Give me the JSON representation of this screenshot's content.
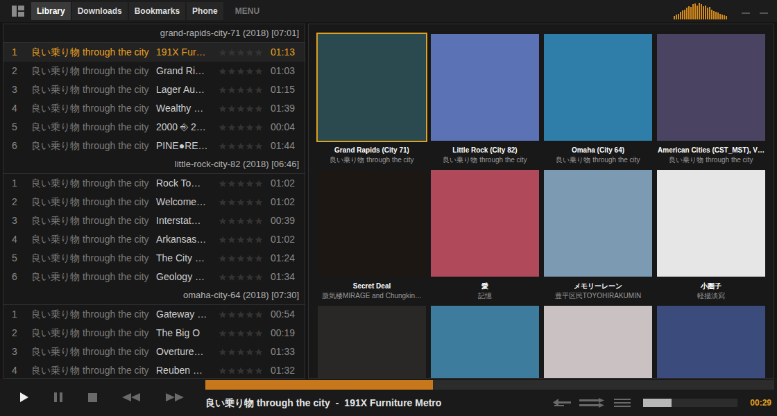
{
  "tabs": [
    {
      "label": "Library",
      "selected": true
    },
    {
      "label": "Downloads",
      "selected": false
    },
    {
      "label": "Bookmarks",
      "selected": false
    },
    {
      "label": "Phone",
      "selected": false
    }
  ],
  "menu": "MENU",
  "spectrum": [
    0.2,
    0.3,
    0.35,
    0.45,
    0.55,
    0.6,
    0.7,
    0.8,
    0.75,
    0.9,
    0.95,
    0.85,
    1,
    0.9,
    0.8,
    0.85,
    0.7,
    0.75,
    0.6,
    0.5,
    0.45,
    0.4,
    0.35,
    0.3,
    0.25,
    0.2
  ],
  "library": {
    "groups": [
      {
        "header": "grand-rapids-city-71 (2018) [07:01]",
        "tracks": [
          {
            "number": "1",
            "artist": "良い乗り物 through the city",
            "title": "191X Fur…",
            "stars": 0,
            "duration": "01:13",
            "selected": true
          },
          {
            "number": "2",
            "artist": "良い乗り物 through the city",
            "title": "Grand Ri…",
            "stars": 0,
            "duration": "01:03",
            "selected": false
          },
          {
            "number": "3",
            "artist": "良い乗り物 through the city",
            "title": "Lager Au…",
            "stars": 0,
            "duration": "01:15",
            "selected": false
          },
          {
            "number": "4",
            "artist": "良い乗り物 through the city",
            "title": "Wealthy …",
            "stars": 0,
            "duration": "01:39",
            "selected": false
          },
          {
            "number": "5",
            "artist": "良い乗り物 through the city",
            "title": "2000 ⎆ 2…",
            "stars": 0,
            "duration": "00:04",
            "selected": false
          },
          {
            "number": "6",
            "artist": "良い乗り物 through the city",
            "title": "PINE●RE…",
            "stars": 0,
            "duration": "01:44",
            "selected": false
          }
        ]
      },
      {
        "header": "little-rock-city-82 (2018) [06:46]",
        "tracks": [
          {
            "number": "1",
            "artist": "良い乗り物 through the city",
            "title": "Rock To…",
            "stars": 0,
            "duration": "01:02",
            "selected": false
          },
          {
            "number": "2",
            "artist": "良い乗り物 through the city",
            "title": "Welcome…",
            "stars": 0,
            "duration": "01:02",
            "selected": false
          },
          {
            "number": "3",
            "artist": "良い乗り物 through the city",
            "title": "Interstat…",
            "stars": 0,
            "duration": "00:39",
            "selected": false
          },
          {
            "number": "4",
            "artist": "良い乗り物 through the city",
            "title": "Arkansas…",
            "stars": 0,
            "duration": "01:02",
            "selected": false
          },
          {
            "number": "5",
            "artist": "良い乗り物 through the city",
            "title": "The City …",
            "stars": 0,
            "duration": "01:24",
            "selected": false
          },
          {
            "number": "6",
            "artist": "良い乗り物 through the city",
            "title": "Geology …",
            "stars": 0,
            "duration": "01:34",
            "selected": false
          }
        ]
      },
      {
        "header": "omaha-city-64 (2018) [07:30]",
        "tracks": [
          {
            "number": "1",
            "artist": "良い乗り物 through the city",
            "title": "Gateway …",
            "stars": 0,
            "duration": "00:54",
            "selected": false
          },
          {
            "number": "2",
            "artist": "良い乗り物 through the city",
            "title": "The Big O",
            "stars": 0,
            "duration": "00:19",
            "selected": false
          },
          {
            "number": "3",
            "artist": "良い乗り物 through the city",
            "title": "Overture…",
            "stars": 0,
            "duration": "01:33",
            "selected": false
          },
          {
            "number": "4",
            "artist": "良い乗り物 through the city",
            "title": "Reuben …",
            "stars": 0,
            "duration": "01:32",
            "selected": false
          }
        ]
      }
    ]
  },
  "albums": [
    {
      "title": "Grand Rapids (City 71)",
      "artist": "良い乗り物 through the city",
      "color": "#2b4a4f",
      "selected": true
    },
    {
      "title": "Little Rock (City 82)",
      "artist": "良い乗り物 through the city",
      "color": "#5b73b5",
      "selected": false
    },
    {
      "title": "Omaha (City 64)",
      "artist": "良い乗り物 through the city",
      "color": "#2f7eaa",
      "selected": false
    },
    {
      "title": "American Cities (CST_MST), V…",
      "artist": "良い乗り物 through the city",
      "color": "#4a4462",
      "selected": false
    },
    {
      "title": "Secret Deal",
      "artist": "蜃気楼MIRAGE and Chungkin…",
      "color": "#1c1712",
      "selected": false
    },
    {
      "title": "愛",
      "artist": "記憶",
      "color": "#b04a5a",
      "selected": false
    },
    {
      "title": "メモリーレーン",
      "artist": "豊平区民TOYOHIRAKUMIN",
      "color": "#7c9bb2",
      "selected": false
    },
    {
      "title": "小圏子",
      "artist": "軽描淡寫",
      "color": "#e6e6e6",
      "selected": false
    },
    {
      "color": "#2a2826",
      "selected": false
    },
    {
      "color": "#3d7c9c",
      "selected": false
    },
    {
      "color": "#c9c1c2",
      "selected": false
    },
    {
      "color": "#3b4b7c",
      "selected": false
    }
  ],
  "player": {
    "progress": 0.4,
    "now_playing": {
      "artist": "良い乗り物 through the city",
      "separator": "-",
      "title": "191X Furniture Metro"
    },
    "volume": 0.3,
    "time": "00:29"
  }
}
